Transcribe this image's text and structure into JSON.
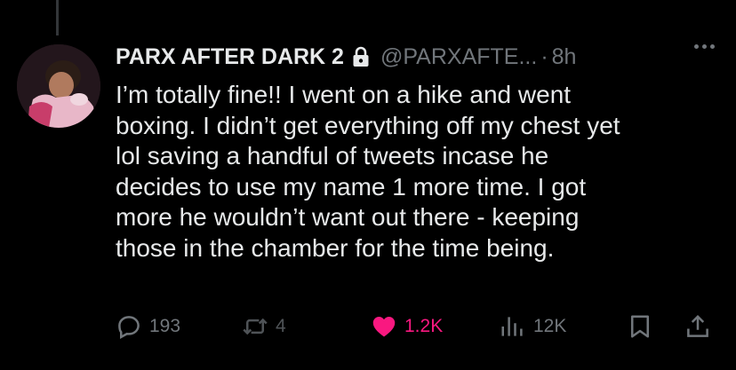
{
  "tweet": {
    "display_name": "PARX AFTER DARK 2",
    "handle": "@PARXAFTE...",
    "separator": "·",
    "time": "8h",
    "text": "I’m totally fine!! I went on a hike and went boxing. I didn’t get everything off my chest yet lol saving a handful of tweets incase he decides to use my name 1 more time. I got more he wouldn’t want out there - keeping those in the chamber for the time being.",
    "lines": [
      "I’m totally fine!! I went on a hike and went",
      "boxing. I didn’t get everything off my chest yet",
      "lol saving a handful of tweets incase he",
      "decides to use my name 1 more time. I got",
      "more he wouldn’t want out there - keeping",
      "those in the chamber for the time being."
    ]
  },
  "actions": {
    "replies": "193",
    "reposts": "4",
    "likes": "1.2K",
    "views": "12K"
  },
  "colors": {
    "background": "#000000",
    "text": "#e7e9ea",
    "muted": "#71767b",
    "like": "#f91880"
  },
  "icons": [
    "lock-icon",
    "more-icon",
    "reply-icon",
    "repost-icon",
    "heart-icon",
    "views-icon",
    "bookmark-icon",
    "share-icon"
  ]
}
